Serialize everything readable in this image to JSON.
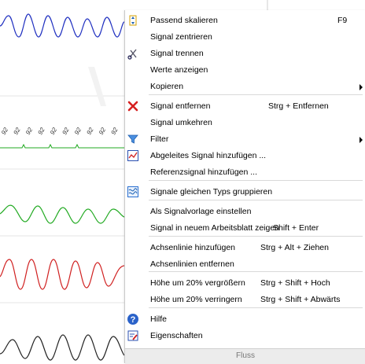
{
  "colors": {
    "blue_signal": "#2030c0",
    "green_signal": "#22aa22",
    "red_signal": "#d02020",
    "black_signal": "#222222",
    "menu_separator": "#d9d9d9",
    "footer_bg": "#ececec"
  },
  "background": {
    "axis_labels": [
      "92",
      "92",
      "92",
      "92",
      "92",
      "92",
      "92",
      "92",
      "92",
      "92"
    ]
  },
  "context_menu": {
    "items": [
      {
        "label": "Passend skalieren",
        "shortcut": "F9",
        "icon": "fit-scale-icon"
      },
      {
        "label": "Signal zentrieren"
      },
      {
        "label": "Signal trennen",
        "icon": "scissors-icon"
      },
      {
        "label": "Werte anzeigen"
      },
      {
        "label": "Kopieren",
        "submenu": true
      },
      {
        "label": "Signal entfernen",
        "shortcut": "Strg + Entfernen",
        "icon": "remove-x-icon"
      },
      {
        "label": "Signal umkehren"
      },
      {
        "label": "Filter",
        "submenu": true,
        "icon": "filter-funnel-icon"
      },
      {
        "label": "Abgeleites Signal hinzufügen ...",
        "icon": "derived-signal-icon"
      },
      {
        "label": "Referenzsignal hinzufügen ..."
      },
      {
        "label": "Signale gleichen Typs gruppieren",
        "icon": "group-signals-icon"
      },
      {
        "label": "Als Signalvorlage einstellen"
      },
      {
        "label": "Signal in neuem Arbeitsblatt zeigen",
        "shortcut": "Shift + Enter"
      },
      {
        "label": "Achsenlinie hinzufügen",
        "shortcut": "Strg + Alt + Ziehen"
      },
      {
        "label": "Achsenlinien entfernen"
      },
      {
        "label": "Höhe um 20% vergrößern",
        "shortcut": "Strg + Shift + Hoch"
      },
      {
        "label": "Höhe um 20% verringern",
        "shortcut": "Strg + Shift + Abwärts"
      },
      {
        "label": "Hilfe",
        "icon": "help-icon"
      },
      {
        "label": "Eigenschaften",
        "icon": "properties-icon"
      }
    ],
    "footer": "Fluss"
  }
}
